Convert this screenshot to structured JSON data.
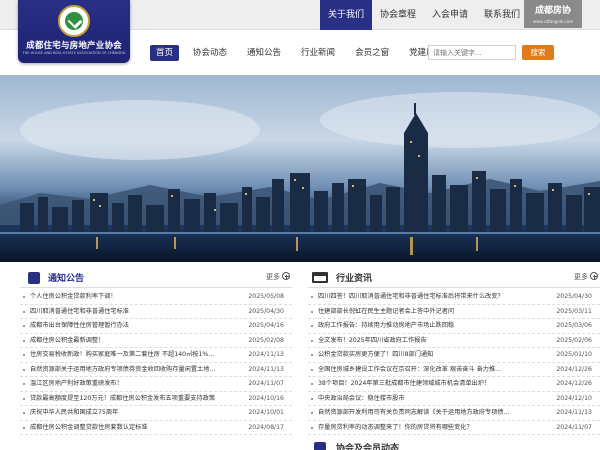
{
  "logo": {
    "name_cn": "成都住宅与房地产业协会",
    "name_en": "THE HOUSE AND REAL ESTATE ASSOCIATION OF CHENGDU"
  },
  "topnav": [
    {
      "label": "关于我们",
      "active": true
    },
    {
      "label": "协会章程",
      "active": false
    },
    {
      "label": "入会申请",
      "active": false
    },
    {
      "label": "联系我们",
      "active": false
    }
  ],
  "brand_badge": {
    "title": "成都房协",
    "subtitle": "www.cdfangxie.com"
  },
  "mainnav": [
    {
      "label": "首页",
      "active": true
    },
    {
      "label": "协会动态",
      "active": false
    },
    {
      "label": "通知公告",
      "active": false
    },
    {
      "label": "行业新闻",
      "active": false
    },
    {
      "label": "会员之窗",
      "active": false
    },
    {
      "label": "党建风采",
      "active": false
    }
  ],
  "search": {
    "placeholder": "请输入关键字...",
    "button": "搜索"
  },
  "notice": {
    "title": "通知公告",
    "more": "更多",
    "items": [
      {
        "text": "个人住房公积金贷款利率下调！",
        "date": "2025/05/08"
      },
      {
        "text": "四川取消普通住宅和非普通住宅标准",
        "date": "2025/04/30"
      },
      {
        "text": "成都市出台保障性住房管理暂行办法",
        "date": "2025/04/16"
      },
      {
        "text": "成都住房公积金最新调整！",
        "date": "2025/02/08"
      },
      {
        "text": "住房交易税收新政！购买家庭唯一及第二套住房 不超140㎡按1%...",
        "date": "2024/11/13"
      },
      {
        "text": "自然资源部关于运用地方政府专项债券资金收回收购存量闲置土地...",
        "date": "2024/11/13"
      },
      {
        "text": "温江区房地产利好政策重磅发布！",
        "date": "2024/11/07"
      },
      {
        "text": "贷款最高额度提至120万元！成都住房公积金发布五项重要支持政策",
        "date": "2024/10/16"
      },
      {
        "text": "庆祝中华人民共和国成立75周年",
        "date": "2024/10/01"
      },
      {
        "text": "成都住房公积金调整贷款住房套数认定标准",
        "date": "2024/08/17"
      }
    ]
  },
  "news": {
    "title": "行业资讯",
    "more": "更多",
    "items": [
      {
        "text": "四川四答！四川取消普通住宅和非普通住宅标准后将带来什么改变？",
        "date": "2025/04/30"
      },
      {
        "text": "住建部部长倪虹在民生主题记者会上答中外记者问",
        "date": "2025/03/11"
      },
      {
        "text": "政府工作报告：持续用力推动房地产市场止跌回稳",
        "date": "2025/03/06"
      },
      {
        "text": "全文发布！2025年四川省政府工作报告",
        "date": "2025/02/06"
      },
      {
        "text": "公积金贷款买房更方便了！四川8部门通知",
        "date": "2025/01/10"
      },
      {
        "text": "全国住房城乡建设工作会议在京召开：深化改革 艰苦奋斗 奋力推...",
        "date": "2024/12/26"
      },
      {
        "text": "38个项目！2024年第三批成都市住建领域城市机会清单出炉！",
        "date": "2024/12/26"
      },
      {
        "text": "中央政治局会议：稳住楼市股市",
        "date": "2024/12/10"
      },
      {
        "text": "自然资源部开发利用司有关负责同志解读《关于运用地方政府专项债...",
        "date": "2024/11/13"
      },
      {
        "text": "存量房贷利率的动态调整来了！你的房贷将有哪些变化？",
        "date": "2024/11/07"
      }
    ]
  },
  "members": {
    "title": "协会及会员动态"
  }
}
